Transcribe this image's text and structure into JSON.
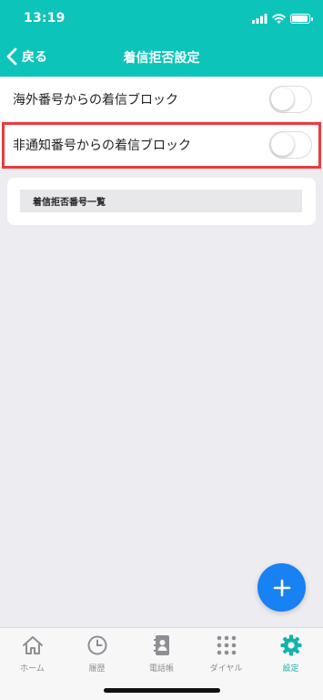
{
  "status_bar": {
    "time": "13:19"
  },
  "nav": {
    "back_label": "戻る",
    "title": "着信拒否設定"
  },
  "settings": [
    {
      "label": "海外番号からの着信ブロック",
      "enabled": false
    },
    {
      "label": "非通知番号からの着信ブロック",
      "enabled": false
    }
  ],
  "block_list": {
    "header": "着信拒否番号一覧"
  },
  "tabs": [
    {
      "label": "ホーム",
      "icon": "home-icon"
    },
    {
      "label": "履歴",
      "icon": "clock-icon"
    },
    {
      "label": "電話帳",
      "icon": "contacts-icon"
    },
    {
      "label": "ダイヤル",
      "icon": "dialpad-icon"
    },
    {
      "label": "設定",
      "icon": "gear-icon",
      "active": true
    }
  ],
  "colors": {
    "accent": "#0cc4b9",
    "fab": "#1881f3",
    "highlight": "#ee3a3a",
    "active_tab": "#11b3aa"
  }
}
